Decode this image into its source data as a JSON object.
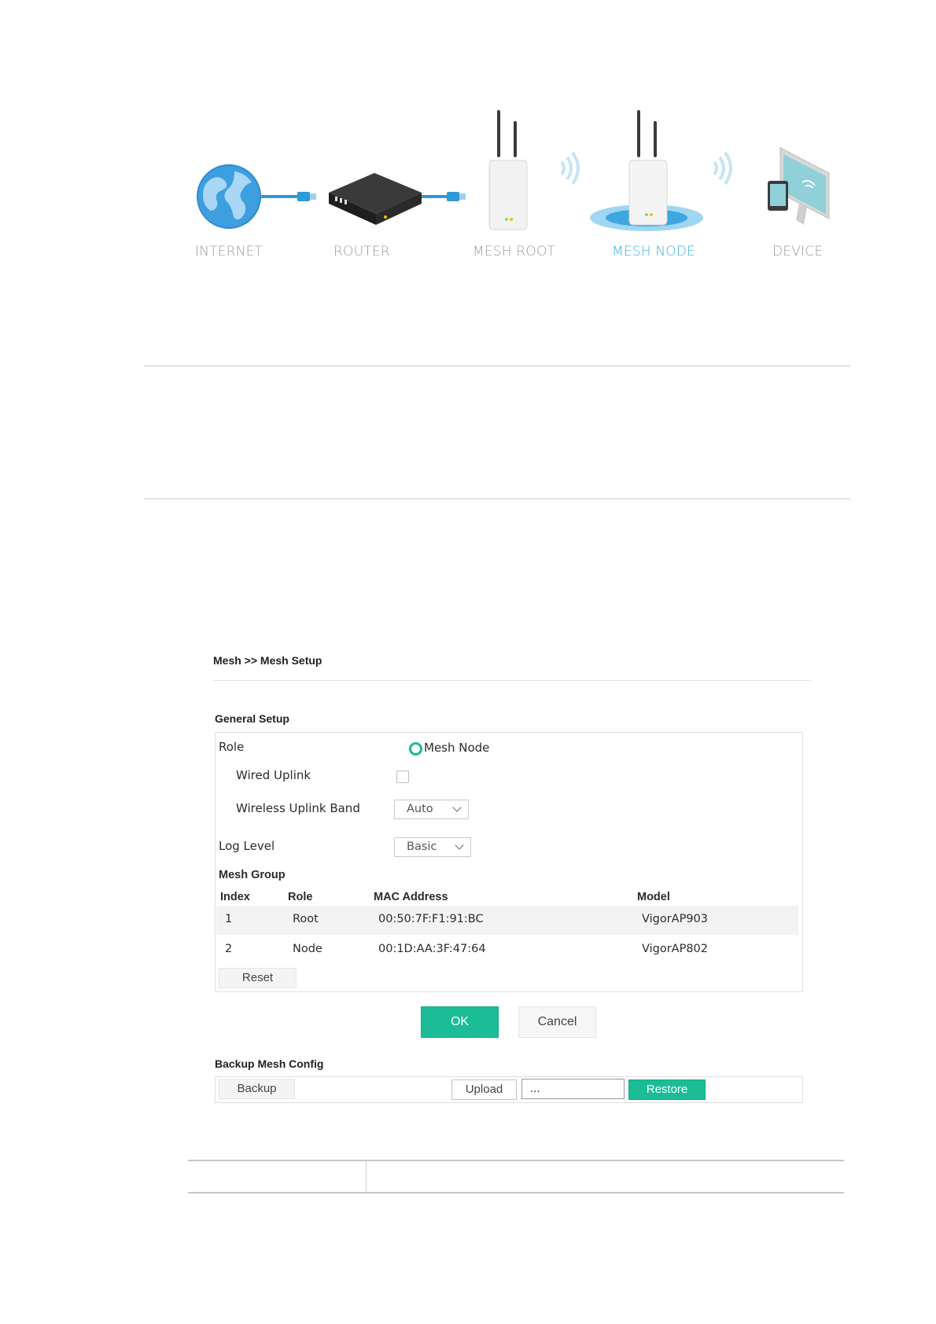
{
  "diagram": {
    "labels": {
      "internet": "INTERNET",
      "router": "ROUTER",
      "mesh_root": "MESH ROOT",
      "mesh_node": "MESH NODE",
      "device": "DEVICE"
    },
    "active_node": "MESH NODE",
    "colors": {
      "active": "#3eaee0",
      "inactive": "#9a9a9a",
      "cable": "#2e9ad6"
    }
  },
  "breadcrumb": "Mesh >> Mesh Setup",
  "general_setup": {
    "title": "General Setup",
    "role_label": "Role",
    "role_value": "Mesh Node",
    "wired_uplink_label": "Wired Uplink",
    "wired_uplink_checked": false,
    "wireless_uplink_band_label": "Wireless Uplink Band",
    "wireless_uplink_band_value": "Auto",
    "log_level_label": "Log Level",
    "log_level_value": "Basic"
  },
  "mesh_group": {
    "title": "Mesh Group",
    "columns": [
      "Index",
      "Role",
      "MAC Address",
      "Model"
    ],
    "rows": [
      {
        "index": "1",
        "role": "Root",
        "mac": "00:50:7F:F1:91:BC",
        "model": "VigorAP903"
      },
      {
        "index": "2",
        "role": "Node",
        "mac": "00:1D:AA:3F:47:64",
        "model": "VigorAP802"
      }
    ],
    "reset_label": "Reset"
  },
  "actions": {
    "ok_label": "OK",
    "cancel_label": "Cancel"
  },
  "backup": {
    "title": "Backup Mesh Config",
    "backup_label": "Backup",
    "upload_label": "Upload",
    "file_value": "...",
    "restore_label": "Restore"
  },
  "accent_color": "#1bbc96"
}
